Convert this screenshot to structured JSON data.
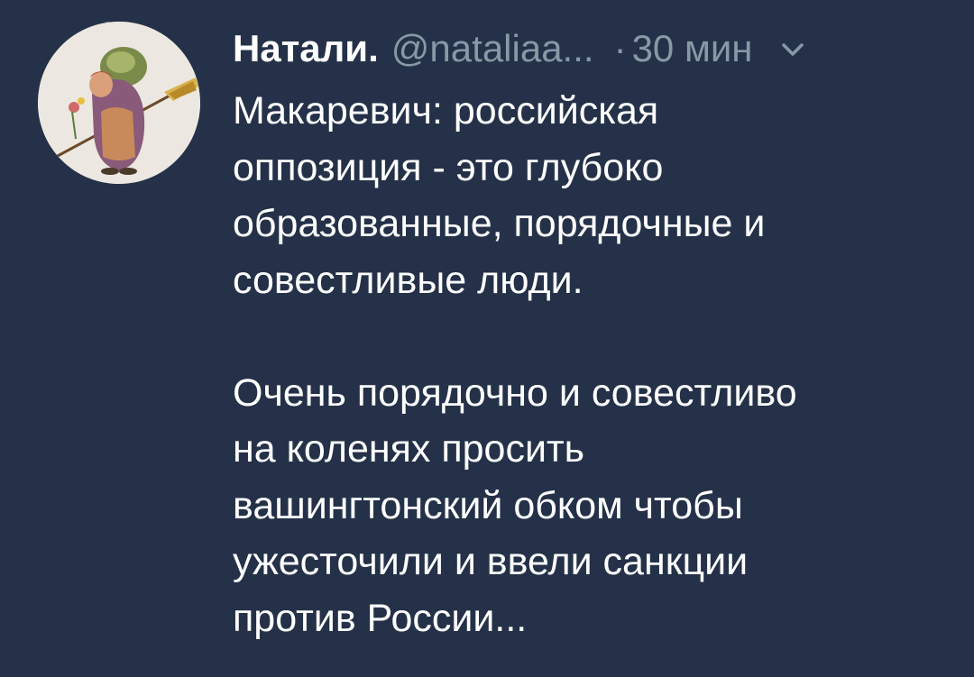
{
  "tweet": {
    "display_name": "Натали.",
    "handle": "@nataliaa...",
    "separator": "·",
    "time": "30 мин",
    "icons": {
      "avatar": "avatar-image",
      "menu": "chevron-down-icon"
    },
    "paragraph1": [
      "Макаревич: российская",
      "оппозиция - это глубоко",
      "образованные, порядочные и",
      "совестливые люди."
    ],
    "paragraph2": [
      "Очень порядочно и совестливо",
      "на коленях просить",
      "вашингтонский обком чтобы",
      "ужесточили и ввели санкции",
      "против России..."
    ],
    "colors": {
      "background": "#243148",
      "text": "#ffffff",
      "secondary": "#8899a6"
    }
  }
}
